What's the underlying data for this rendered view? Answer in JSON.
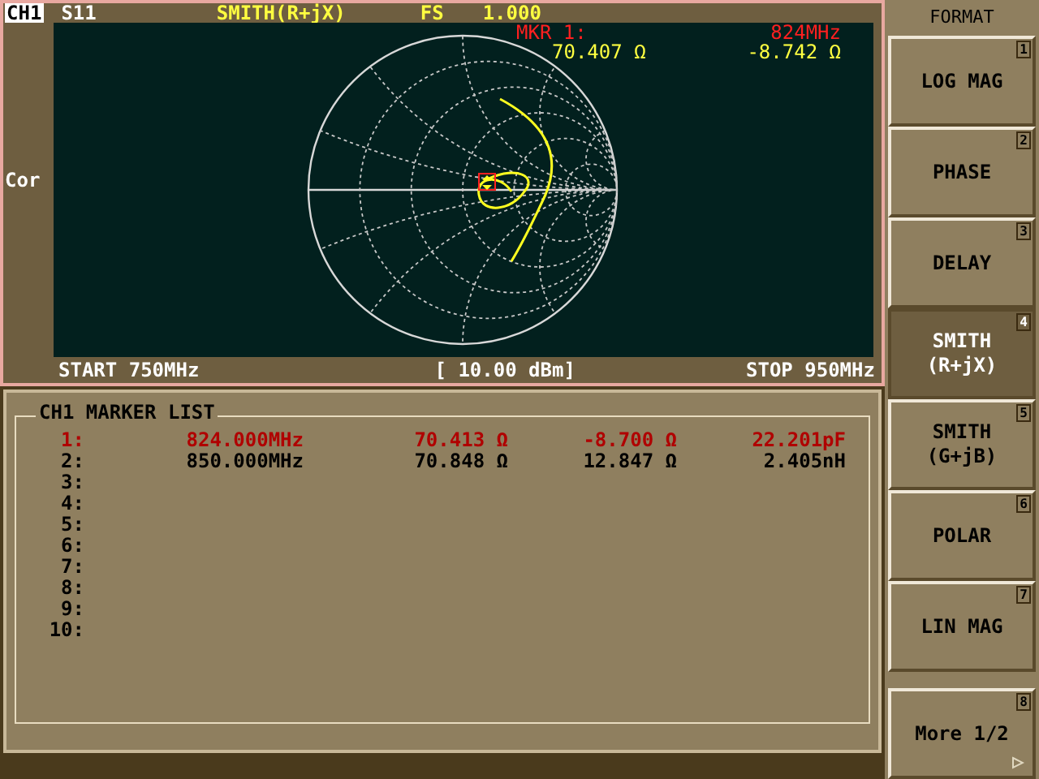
{
  "header": {
    "channel": "CH1",
    "parameter": "S11",
    "format": "SMITH(R+jX)",
    "scale_label": "FS",
    "scale_value": "1.000"
  },
  "side_label": "Cor",
  "marker_readout": {
    "label": "MKR  1:",
    "frequency": "824MHz",
    "resistance": "70.407 Ω",
    "reactance": "-8.742 Ω"
  },
  "footer": {
    "start": "START 750MHz",
    "power": "[ 10.00 dBm]",
    "stop": "STOP 950MHz"
  },
  "marker_list": {
    "title": "CH1 MARKER LIST",
    "rows": [
      {
        "index": "1:",
        "frequency": "824.000MHz",
        "resistance": "70.413 Ω",
        "reactance": "-8.700 Ω",
        "component": "22.201pF",
        "active": true
      },
      {
        "index": "2:",
        "frequency": "850.000MHz",
        "resistance": "70.848 Ω",
        "reactance": "12.847 Ω",
        "component": "2.405nH",
        "active": false
      },
      {
        "index": "3:",
        "active": false
      },
      {
        "index": "4:",
        "active": false
      },
      {
        "index": "5:",
        "active": false
      },
      {
        "index": "6:",
        "active": false
      },
      {
        "index": "7:",
        "active": false
      },
      {
        "index": "8:",
        "active": false
      },
      {
        "index": "9:",
        "active": false
      },
      {
        "index": "10:",
        "active": false
      }
    ]
  },
  "softkeys": {
    "title": "FORMAT",
    "keys": [
      {
        "label": "LOG MAG",
        "number": "1",
        "selected": false
      },
      {
        "label": "PHASE",
        "number": "2",
        "selected": false
      },
      {
        "label": "DELAY",
        "number": "3",
        "selected": false
      },
      {
        "label": "SMITH\n(R+jX)",
        "number": "4",
        "selected": true
      },
      {
        "label": "SMITH\n(G+jB)",
        "number": "5",
        "selected": false
      },
      {
        "label": "POLAR",
        "number": "6",
        "selected": false
      },
      {
        "label": "LIN MAG",
        "number": "7",
        "selected": false
      },
      {
        "label": "More 1/2",
        "number": "8",
        "selected": false
      }
    ]
  }
}
